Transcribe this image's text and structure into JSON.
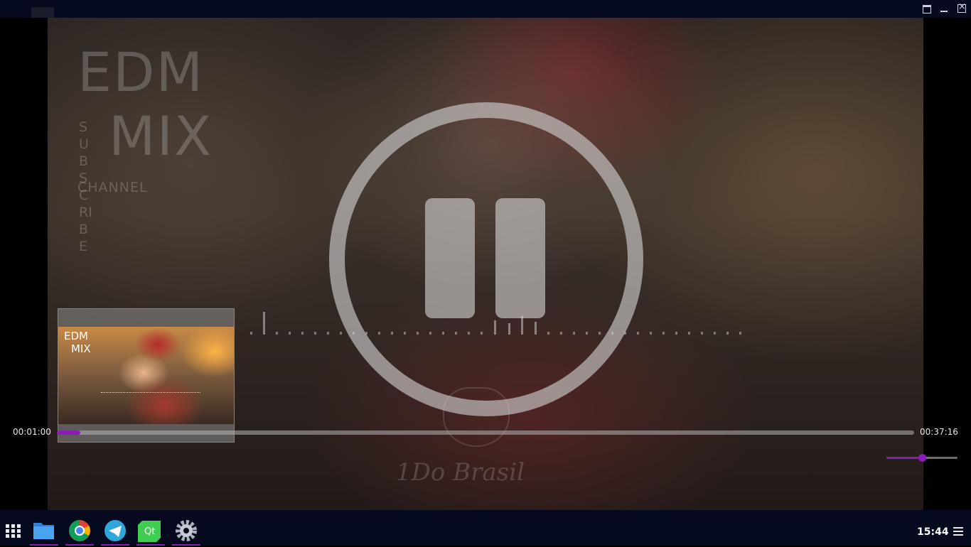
{
  "window": {
    "controls": [
      "maximize-icon",
      "minimize-icon",
      "close-icon"
    ]
  },
  "video": {
    "overlay_text": {
      "logo_line1": "EDM",
      "logo_line2": "MIX",
      "logo_vertical": "SUBSCRIBE",
      "logo_channel": "CHANNEL",
      "signature": "1Do Brasil"
    },
    "state": "paused-overlay",
    "center_icon": "pause-icon"
  },
  "thumbnail": {
    "line1": "EDM",
    "line2": "MIX"
  },
  "player": {
    "time_current": "00:01:00",
    "time_total": "00:37:16",
    "progress_fraction": 0.027,
    "volume_fraction": 0.5,
    "accent_color": "#8a1cb8"
  },
  "taskbar": {
    "apps": [
      {
        "name": "files-icon",
        "running": true
      },
      {
        "name": "chrome-icon",
        "running": true
      },
      {
        "name": "telegram-icon",
        "running": true
      },
      {
        "name": "qt-creator-icon",
        "running": true
      },
      {
        "name": "settings-icon",
        "running": true
      }
    ],
    "clock": "15:44"
  }
}
